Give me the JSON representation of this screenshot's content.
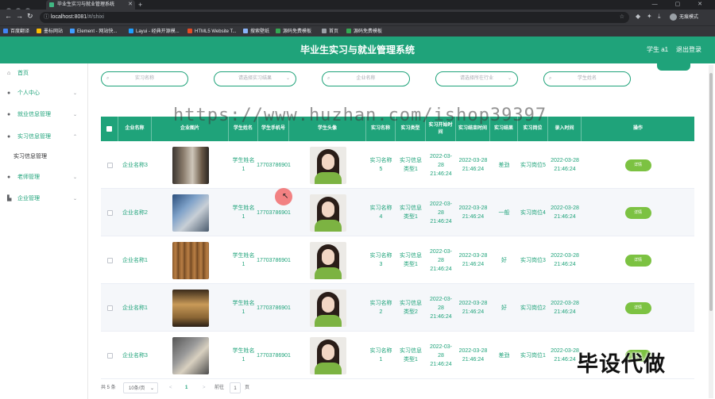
{
  "browser": {
    "tab_title": "毕业生实习与就业管理系统",
    "new_tab": "+",
    "window_buttons": "— ▢ ✕",
    "url_host": "localhost:8081",
    "url_path": "/#/shixi",
    "profile_label": "无痕模式",
    "bookmarks": [
      "百度翻译",
      "墨标网站",
      "Element - 网站快...",
      "Layui - 经典开源模...",
      "HTML5 Website T...",
      "搜索壁纸",
      "源码免费模板",
      "首页",
      "源码免费模板"
    ]
  },
  "header": {
    "title": "毕业生实习与就业管理系统",
    "user": "学生 a1",
    "logout": "退出登录"
  },
  "sidebar": {
    "items": [
      {
        "label": "首页"
      },
      {
        "label": "个人中心"
      },
      {
        "label": "就业信息管理"
      },
      {
        "label": "实习信息管理"
      },
      {
        "label": "实习信息管理"
      },
      {
        "label": "老师管理"
      },
      {
        "label": "企业管理"
      }
    ]
  },
  "search": {
    "fields": [
      {
        "placeholder": "实习名称"
      },
      {
        "placeholder": "请选择实习结果"
      },
      {
        "placeholder": "企业名称"
      },
      {
        "placeholder": "请选择所在行业"
      },
      {
        "placeholder": "学生姓名"
      }
    ]
  },
  "watermark": "https://www.huzhan.com/ishop39397",
  "table": {
    "headers": [
      "企业名称",
      "企业图片",
      "学生姓名",
      "学生手机号",
      "学生头像",
      "实习名称",
      "实习类型",
      "实习开始时间",
      "实习结束时间",
      "实习结果",
      "实习岗位",
      "录入时间",
      "操作"
    ],
    "rows": [
      {
        "company": "企业名称3",
        "student": "学生姓名1",
        "phone": "17703786901",
        "intern": "实习名称5",
        "type": "实习信息类型1",
        "start": "2022-03-28 21:46:24",
        "end": "2022-03-28 21:46:24",
        "result": "差劲",
        "post": "实习岗位5",
        "created": "2022-03-28 21:46:24",
        "action": "详情"
      },
      {
        "company": "企业名称2",
        "student": "学生姓名1",
        "phone": "17703786901",
        "intern": "实习名称4",
        "type": "实习信息类型1",
        "start": "2022-03-28 21:46:24",
        "end": "2022-03-28 21:46:24",
        "result": "一般",
        "post": "实习岗位4",
        "created": "2022-03-28 21:46:24",
        "action": "详情"
      },
      {
        "company": "企业名称1",
        "student": "学生姓名1",
        "phone": "17703786901",
        "intern": "实习名称3",
        "type": "实习信息类型1",
        "start": "2022-03-28 21:46:24",
        "end": "2022-03-28 21:46:24",
        "result": "好",
        "post": "实习岗位3",
        "created": "2022-03-28 21:46:24",
        "action": "详情"
      },
      {
        "company": "企业名称1",
        "student": "学生姓名1",
        "phone": "17703786901",
        "intern": "实习名称2",
        "type": "实习信息类型2",
        "start": "2022-03-28 21:46:24",
        "end": "2022-03-28 21:46:24",
        "result": "好",
        "post": "实习岗位2",
        "created": "2022-03-28 21:46:24",
        "action": "详情"
      },
      {
        "company": "企业名称3",
        "student": "学生姓名1",
        "phone": "17703786901",
        "intern": "实习名称1",
        "type": "实习信息类型1",
        "start": "2022-03-28 21:46:24",
        "end": "2022-03-28 21:46:24",
        "result": "差劲",
        "post": "实习岗位1",
        "created": "2022-03-28 21:46:24",
        "action": "详情"
      }
    ]
  },
  "pager": {
    "total": "共 5 条",
    "page_size": "10条/页",
    "prev": "<",
    "current": "1",
    "next": ">",
    "goto": "前往",
    "goto_value": "1",
    "page_unit": "页"
  },
  "stamp": "毕设代做"
}
